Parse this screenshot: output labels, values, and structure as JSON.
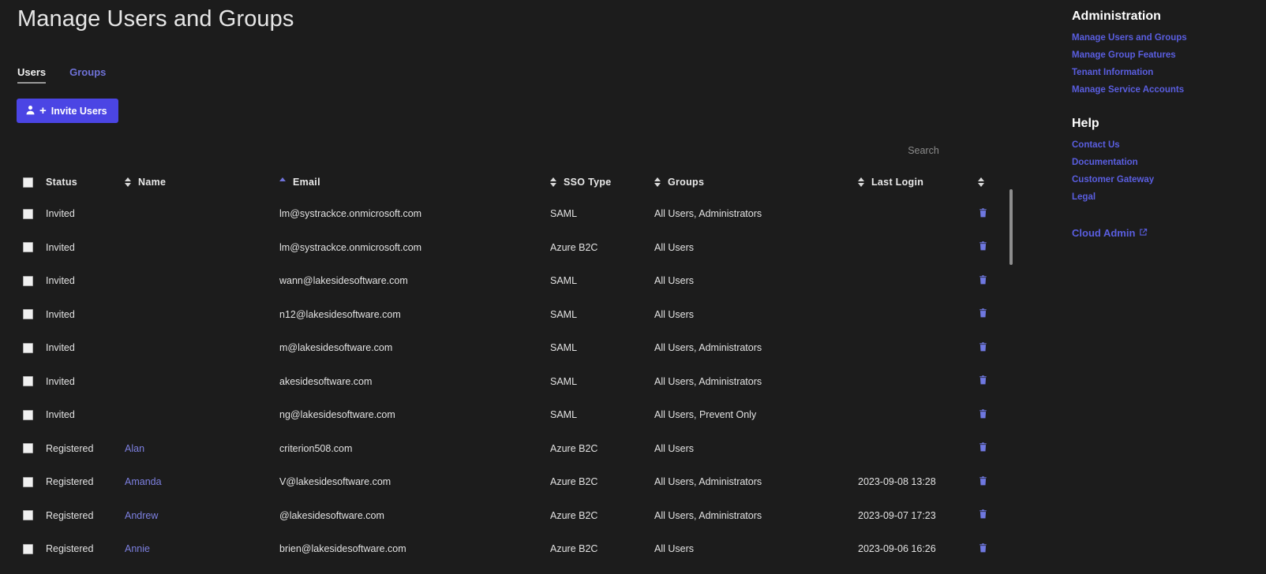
{
  "page": {
    "title": "Manage Users and Groups"
  },
  "tabs": [
    {
      "label": "Users",
      "active": true
    },
    {
      "label": "Groups",
      "active": false
    }
  ],
  "toolbar": {
    "invite_label": "Invite Users",
    "invite_plus": "+"
  },
  "search": {
    "placeholder": "Search",
    "value": ""
  },
  "table": {
    "columns": [
      {
        "key": "status",
        "label": "Status",
        "sort": "none"
      },
      {
        "key": "name",
        "label": "Name",
        "sort": "none"
      },
      {
        "key": "email",
        "label": "Email",
        "sort": "asc"
      },
      {
        "key": "sso",
        "label": "SSO Type",
        "sort": "none"
      },
      {
        "key": "groups",
        "label": "Groups",
        "sort": "none"
      },
      {
        "key": "login",
        "label": "Last Login",
        "sort": "none"
      }
    ],
    "rows": [
      {
        "status": "Invited",
        "name": "",
        "email": "lm@systrackce.onmicrosoft.com",
        "sso": "SAML",
        "groups": "All Users, Administrators",
        "login": ""
      },
      {
        "status": "Invited",
        "name": "",
        "email": "lm@systrackce.onmicrosoft.com",
        "sso": "Azure B2C",
        "groups": "All Users",
        "login": ""
      },
      {
        "status": "Invited",
        "name": "",
        "email": "wann@lakesidesoftware.com",
        "sso": "SAML",
        "groups": "All Users",
        "login": ""
      },
      {
        "status": "Invited",
        "name": "",
        "email": "n12@lakesidesoftware.com",
        "sso": "SAML",
        "groups": "All Users",
        "login": ""
      },
      {
        "status": "Invited",
        "name": "",
        "email": "m@lakesidesoftware.com",
        "sso": "SAML",
        "groups": "All Users, Administrators",
        "login": ""
      },
      {
        "status": "Invited",
        "name": "",
        "email": "akesidesoftware.com",
        "sso": "SAML",
        "groups": "All Users, Administrators",
        "login": ""
      },
      {
        "status": "Invited",
        "name": "",
        "email": "ng@lakesidesoftware.com",
        "sso": "SAML",
        "groups": "All Users, Prevent Only",
        "login": ""
      },
      {
        "status": "Registered",
        "name": "Alan",
        "email": "criterion508.com",
        "sso": "Azure B2C",
        "groups": "All Users",
        "login": ""
      },
      {
        "status": "Registered",
        "name": "Amanda \u0001",
        "email": "V@lakesidesoftware.com",
        "sso": "Azure B2C",
        "groups": "All Users, Administrators",
        "login": "2023-09-08 13:28"
      },
      {
        "status": "Registered",
        "name": "Andrew",
        "email": "@lakesidesoftware.com",
        "sso": "Azure B2C",
        "groups": "All Users, Administrators",
        "login": "2023-09-07 17:23"
      },
      {
        "status": "Registered",
        "name": "Annie",
        "email": "brien@lakesidesoftware.com",
        "sso": "Azure B2C",
        "groups": "All Users",
        "login": "2023-09-06 16:26"
      }
    ]
  },
  "rail": {
    "administration": {
      "heading": "Administration",
      "links": [
        "Manage Users and Groups",
        "Manage Group Features",
        "Tenant Information",
        "Manage Service Accounts"
      ]
    },
    "help": {
      "heading": "Help",
      "links": [
        "Contact Us",
        "Documentation",
        "Customer Gateway",
        "Legal"
      ]
    },
    "cloud_admin": "Cloud Admin"
  },
  "colors": {
    "background": "#1c1c1c",
    "accent_button": "#4b45e4",
    "link": "#5a5ee0",
    "name_link": "#7d80e0",
    "trash": "#6f78e0",
    "text": "#e2e2e2"
  }
}
